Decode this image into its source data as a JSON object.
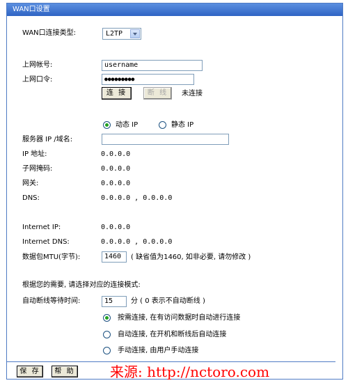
{
  "panel": {
    "title": "WAN口设置"
  },
  "wan": {
    "type_label": "WAN口连接类型:",
    "type_selected": "L2TP",
    "account_label": "上网帐号:",
    "account_value": "username",
    "password_label": "上网口令:",
    "password_mask": "●●●●●●●●●"
  },
  "connect": {
    "connect_label": "连 接",
    "disconnect_label": "断 线",
    "status": "未连接"
  },
  "ipmode": {
    "dynamic_label": "动态 IP",
    "static_label": "静态 IP",
    "selected": "dynamic"
  },
  "server": {
    "label": "服务器 IP /域名:",
    "value": ""
  },
  "info": {
    "ip_label": "IP 地址:",
    "ip_value": "0.0.0.0",
    "mask_label": "子网掩码:",
    "mask_value": "0.0.0.0",
    "gateway_label": "网关:",
    "gateway_value": "0.0.0.0",
    "dns_label": "DNS:",
    "dns_value": "0.0.0.0 , 0.0.0.0",
    "inet_ip_label": "Internet IP:",
    "inet_ip_value": "0.0.0.0",
    "inet_dns_label": "Internet DNS:",
    "inet_dns_value": "0.0.0.0 , 0.0.0.0"
  },
  "mtu": {
    "label": "数据包MTU(字节):",
    "value": "1460",
    "hint": "( 缺省值为1460, 如非必要, 请勿修改 )"
  },
  "mode": {
    "prompt": "根据您的需要, 请选择对应的连接模式:",
    "idle_label": "自动断线等待时间:",
    "idle_value": "15",
    "idle_hint": "分 ( 0 表示不自动断线 )",
    "options": [
      "按需连接, 在有访问数据时自动进行连接",
      "自动连接, 在开机和断线后自动连接",
      "手动连接, 由用户手动连接"
    ],
    "selected_index": 0
  },
  "footer": {
    "save_label": "保 存",
    "help_label": "帮 助",
    "watermark": "来源: http://nctoro.com"
  }
}
